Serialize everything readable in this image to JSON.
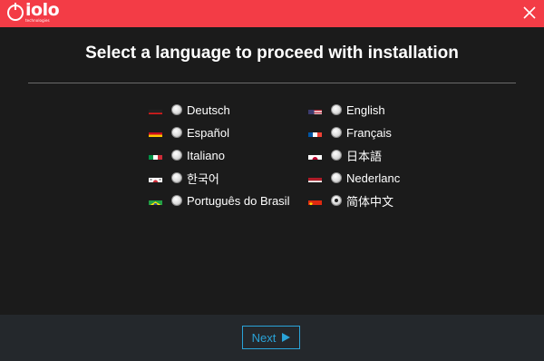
{
  "brand": {
    "name": "iolo",
    "tagline": "technologies"
  },
  "heading": "Select a language to proceed with installation",
  "languages": [
    {
      "id": "de",
      "label": "Deutsch",
      "flag": "flag-germany-icon",
      "selected": false
    },
    {
      "id": "en",
      "label": "English",
      "flag": "flag-usa-icon",
      "selected": false
    },
    {
      "id": "es",
      "label": "Español",
      "flag": "flag-spain-icon",
      "selected": false
    },
    {
      "id": "fr",
      "label": "Français",
      "flag": "flag-france-icon",
      "selected": false
    },
    {
      "id": "it",
      "label": "Italiano",
      "flag": "flag-italy-icon",
      "selected": false
    },
    {
      "id": "ja",
      "label": "日本語",
      "flag": "flag-japan-icon",
      "selected": false
    },
    {
      "id": "ko",
      "label": "한국어",
      "flag": "flag-korea-icon",
      "selected": false
    },
    {
      "id": "nl",
      "label": "Nederlanc",
      "flag": "flag-netherlands-icon",
      "selected": false
    },
    {
      "id": "pt-br",
      "label": "Português do Brasil",
      "flag": "flag-brazil-icon",
      "selected": false
    },
    {
      "id": "zh",
      "label": "简体中文",
      "flag": "flag-china-icon",
      "selected": true
    }
  ],
  "footer": {
    "next_label": "Next"
  },
  "colors": {
    "titlebar": "#f33c46",
    "background": "#1b1b1b",
    "footer": "#24282c",
    "accent": "#2aa3d8"
  }
}
